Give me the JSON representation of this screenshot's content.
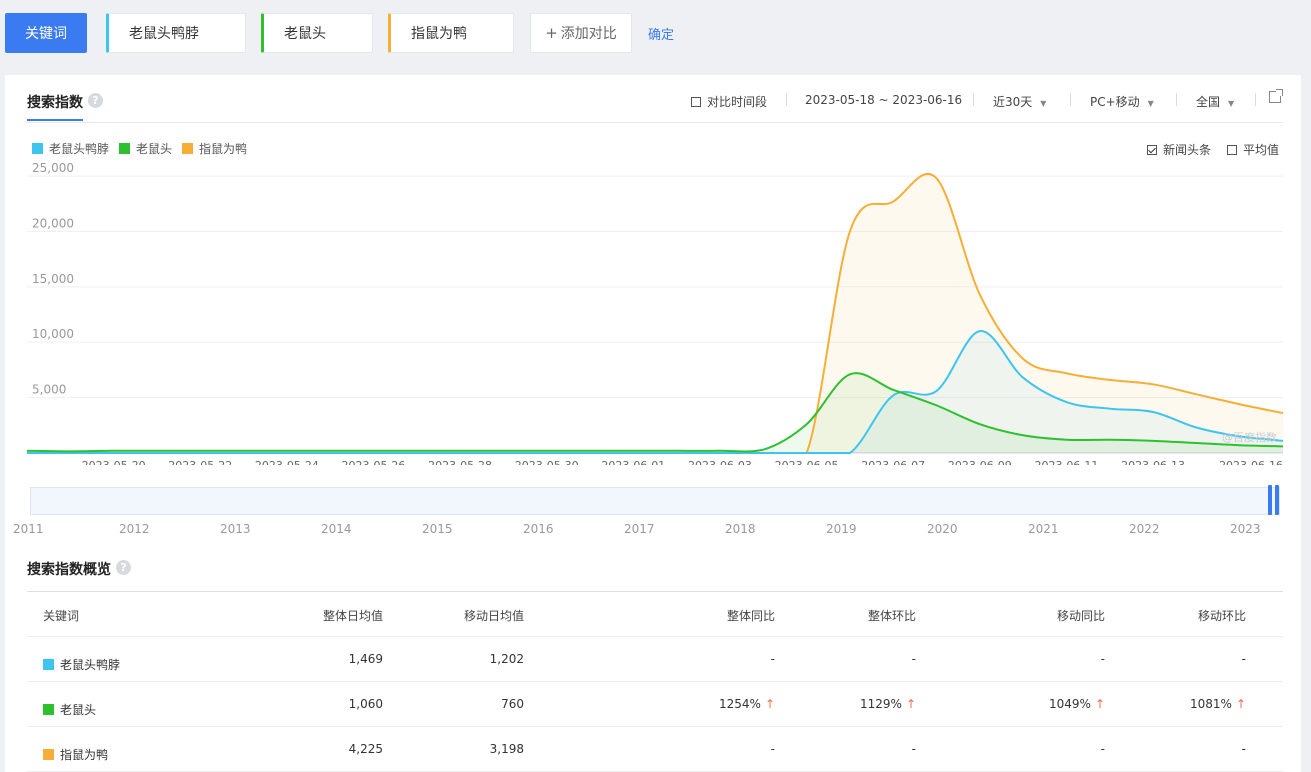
{
  "toolbar": {
    "keyword_button": "关键词",
    "keywords": [
      "老鼠头鸭脖",
      "老鼠头",
      "指鼠为鸭"
    ],
    "add_compare": "添加对比",
    "confirm": "确定"
  },
  "panel": {
    "tab": "搜索指数",
    "compare_period": "对比时间段",
    "date_range": "2023-05-18 ~ 2023-06-16",
    "period": "近30天",
    "device": "PC+移动",
    "region": "全国",
    "news": "新闻头条",
    "average": "平均值",
    "watermark": "@百度指数"
  },
  "colors": {
    "kw1": "#3dc5ef",
    "kw2": "#2ec02e",
    "kw3": "#f7ae37",
    "accent": "#3a7bf2"
  },
  "chart_data": {
    "type": "area",
    "x": [
      "2023-05-18",
      "2023-05-19",
      "2023-05-20",
      "2023-05-21",
      "2023-05-22",
      "2023-05-23",
      "2023-05-24",
      "2023-05-25",
      "2023-05-26",
      "2023-05-27",
      "2023-05-28",
      "2023-05-29",
      "2023-05-30",
      "2023-05-31",
      "2023-06-01",
      "2023-06-02",
      "2023-06-03",
      "2023-06-04",
      "2023-06-05",
      "2023-06-06",
      "2023-06-07",
      "2023-06-08",
      "2023-06-09",
      "2023-06-10",
      "2023-06-11",
      "2023-06-12",
      "2023-06-13",
      "2023-06-14",
      "2023-06-15",
      "2023-06-16"
    ],
    "xticks": [
      "2023-05-20",
      "2023-05-22",
      "2023-05-24",
      "2023-05-26",
      "2023-05-28",
      "2023-05-30",
      "2023-06-01",
      "2023-06-03",
      "2023-06-05",
      "2023-06-07",
      "2023-06-09",
      "2023-06-11",
      "2023-06-13",
      "2023-06-16"
    ],
    "yticks": [
      "25,000",
      "20,000",
      "15,000",
      "10,000",
      "5,000"
    ],
    "ylim": [
      0,
      26000
    ],
    "series": [
      {
        "name": "老鼠头鸭脖",
        "values": [
          0,
          0,
          0,
          0,
          0,
          0,
          0,
          0,
          0,
          0,
          0,
          0,
          0,
          0,
          0,
          0,
          0,
          0,
          0,
          0,
          5200,
          5600,
          11000,
          6800,
          4600,
          4000,
          3700,
          2300,
          1500,
          1100
        ]
      },
      {
        "name": "老鼠头",
        "values": [
          200,
          150,
          200,
          200,
          200,
          200,
          200,
          200,
          200,
          200,
          200,
          200,
          200,
          200,
          200,
          200,
          200,
          300,
          2600,
          7100,
          5700,
          4300,
          2600,
          1600,
          1200,
          1200,
          1100,
          900,
          700,
          600
        ]
      },
      {
        "name": "指鼠为鸭",
        "values": [
          0,
          0,
          0,
          0,
          0,
          0,
          0,
          0,
          0,
          0,
          0,
          0,
          0,
          0,
          0,
          0,
          0,
          0,
          0,
          20000,
          22700,
          24800,
          14300,
          8500,
          7200,
          6600,
          6200,
          5300,
          4400,
          3600
        ]
      }
    ],
    "range_years": [
      "2011",
      "2012",
      "2013",
      "2014",
      "2015",
      "2016",
      "2017",
      "2018",
      "2019",
      "2020",
      "2021",
      "2022",
      "2023"
    ]
  },
  "overview": {
    "title": "搜索指数概览",
    "headers": [
      "关键词",
      "整体日均值",
      "移动日均值",
      "整体同比",
      "整体环比",
      "移动同比",
      "移动环比"
    ],
    "rows": [
      {
        "kw": "老鼠头鸭脖",
        "avg": "1,469",
        "mavg": "1,202",
        "yoy": "-",
        "mom": "-",
        "myoy": "-",
        "mmom": "-"
      },
      {
        "kw": "老鼠头",
        "avg": "1,060",
        "mavg": "760",
        "yoy": "1254%",
        "mom": "1129%",
        "myoy": "1049%",
        "mmom": "1081%"
      },
      {
        "kw": "指鼠为鸭",
        "avg": "4,225",
        "mavg": "3,198",
        "yoy": "-",
        "mom": "-",
        "myoy": "-",
        "mmom": "-"
      }
    ]
  }
}
